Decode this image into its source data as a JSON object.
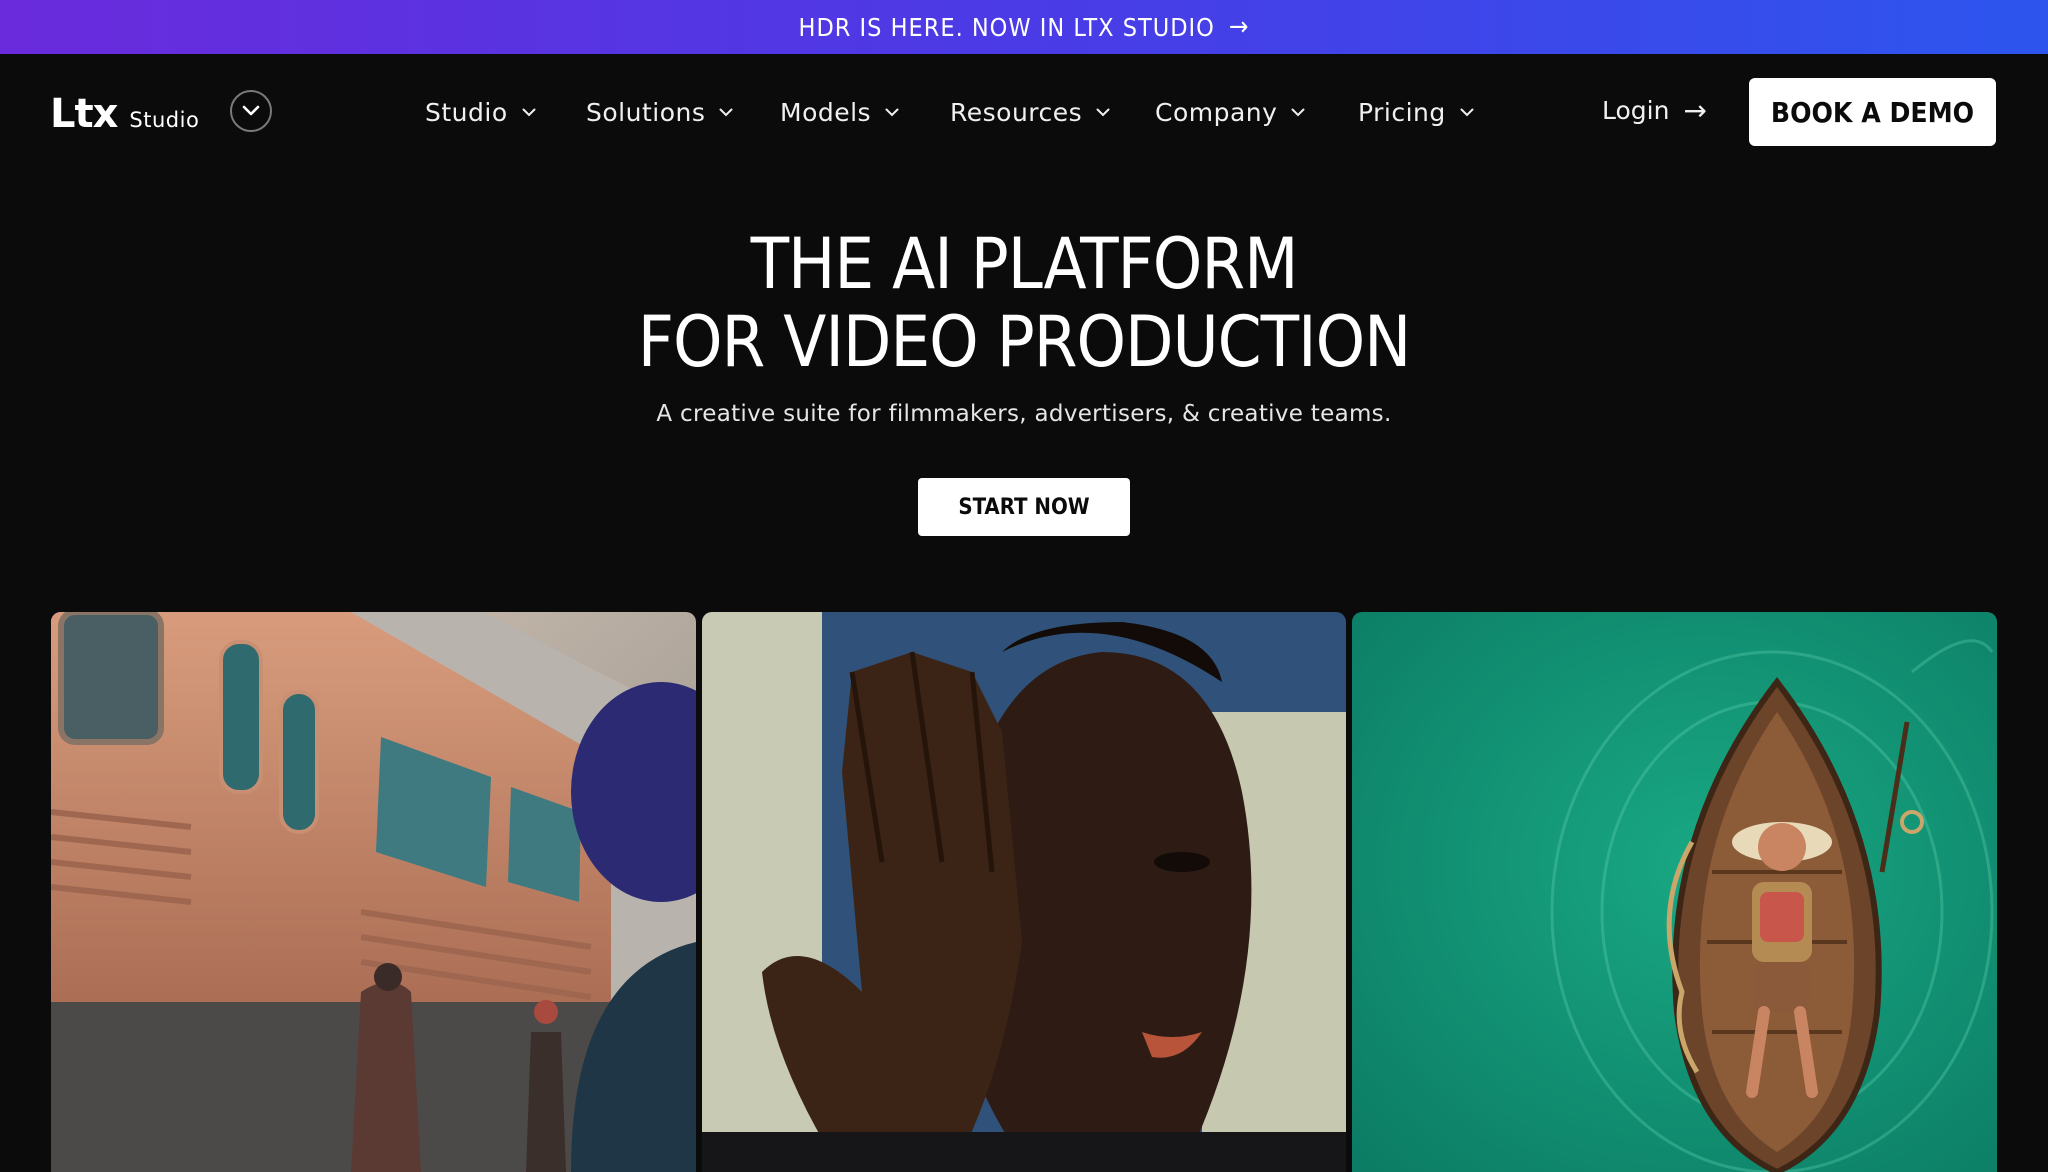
{
  "announcement": {
    "text": "HDR IS HERE. NOW IN LTX STUDIO",
    "arrow": "→"
  },
  "brand": {
    "logo": "Ltx",
    "product": "Studio"
  },
  "nav": {
    "items": [
      {
        "label": "Studio"
      },
      {
        "label": "Solutions"
      },
      {
        "label": "Models"
      },
      {
        "label": "Resources"
      },
      {
        "label": "Company"
      },
      {
        "label": "Pricing"
      }
    ],
    "login": "Login",
    "login_arrow": "→",
    "cta": "BOOK A DEMO"
  },
  "hero": {
    "title_line1": "THE AI PLATFORM",
    "title_line2": "FOR VIDEO PRODUCTION",
    "subtitle": "A creative suite for filmmakers, advertisers, & creative teams.",
    "cta": "START NOW"
  },
  "gallery": {
    "cards": [
      {
        "subject": "train-platform-scene",
        "accent": "#c48a6b"
      },
      {
        "subject": "man-covering-eye-portrait",
        "accent": "#3a5f87"
      },
      {
        "subject": "figure-in-rowboat-on-green-water",
        "accent": "#0f8a6a"
      }
    ]
  },
  "colors": {
    "background": "#0b0b0b",
    "banner_start": "#6a2bdc",
    "banner_end": "#2d55ee",
    "button_bg": "#ffffff",
    "button_text": "#0b0b0b"
  }
}
